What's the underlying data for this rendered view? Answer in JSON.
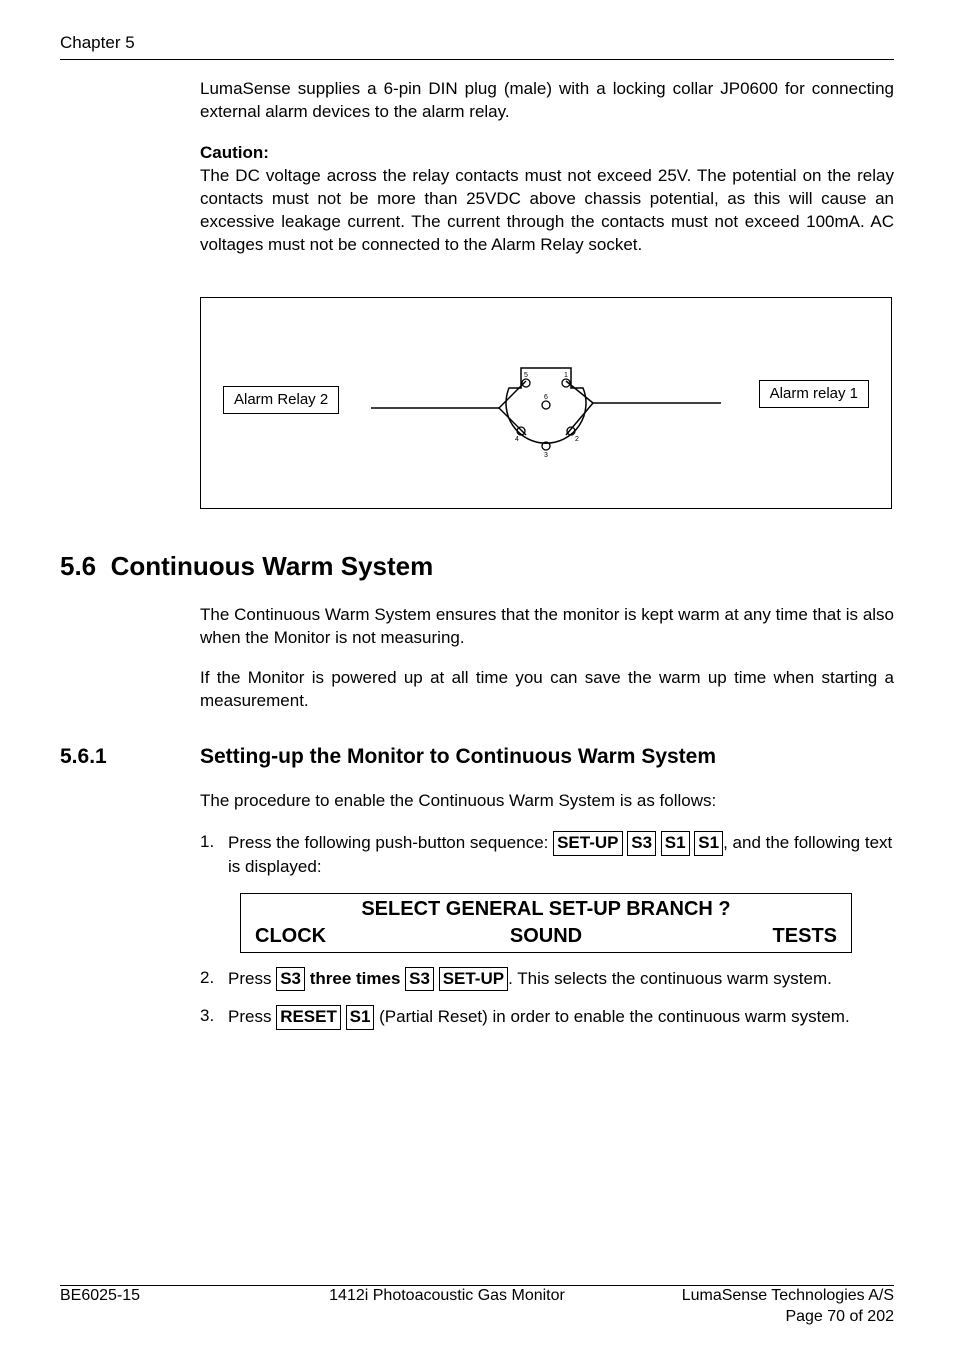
{
  "header": {
    "chapter": "Chapter 5"
  },
  "intro": {
    "p1": "LumaSense supplies a 6-pin DIN plug (male) with a locking collar JP0600 for connecting external alarm devices to the alarm relay.",
    "caution_label": "Caution",
    "caution_text": "The DC voltage across the relay contacts must not exceed 25V. The potential on the relay contacts must not be more than 25VDC above chassis potential, as this will cause an excessive leakage current. The current through the contacts must not exceed 100mA. AC voltages must not be connected to the Alarm Relay socket."
  },
  "diagram": {
    "label_left": "Alarm Relay 2",
    "label_right": "Alarm relay 1"
  },
  "section": {
    "number": "5.6",
    "title": "Continuous Warm System",
    "p1": "The Continuous Warm System ensures that the monitor is kept warm at any time that is also when the Monitor is not measuring.",
    "p2": "If the Monitor is powered up at all time you can save the warm up time when starting a measurement."
  },
  "subsection": {
    "number": "5.6.1",
    "title": "Setting-up the Monitor to Continuous Warm System",
    "intro": "The procedure to enable the Continuous Warm System is as follows:",
    "step1_pre": "Press the following push-button sequence: ",
    "step1_post": ", and the following text is displayed:",
    "keys": {
      "setup": "SET-UP",
      "s3": "S3",
      "s1": "S1",
      "reset": "RESET"
    },
    "display": {
      "title": "SELECT GENERAL SET-UP BRANCH ?",
      "opt1": "CLOCK",
      "opt2": "SOUND",
      "opt3": "TESTS"
    },
    "step2_a": "Press ",
    "step2_b": " three times ",
    "step2_c": ". This selects the continuous warm system.",
    "step3_a": "Press ",
    "step3_b": " (Partial Reset) in order to enable the continuous warm system."
  },
  "footer": {
    "left": "BE6025-15",
    "center": "1412i Photoacoustic Gas Monitor",
    "right": "LumaSense Technologies A/S",
    "page": "Page 70 of 202"
  }
}
